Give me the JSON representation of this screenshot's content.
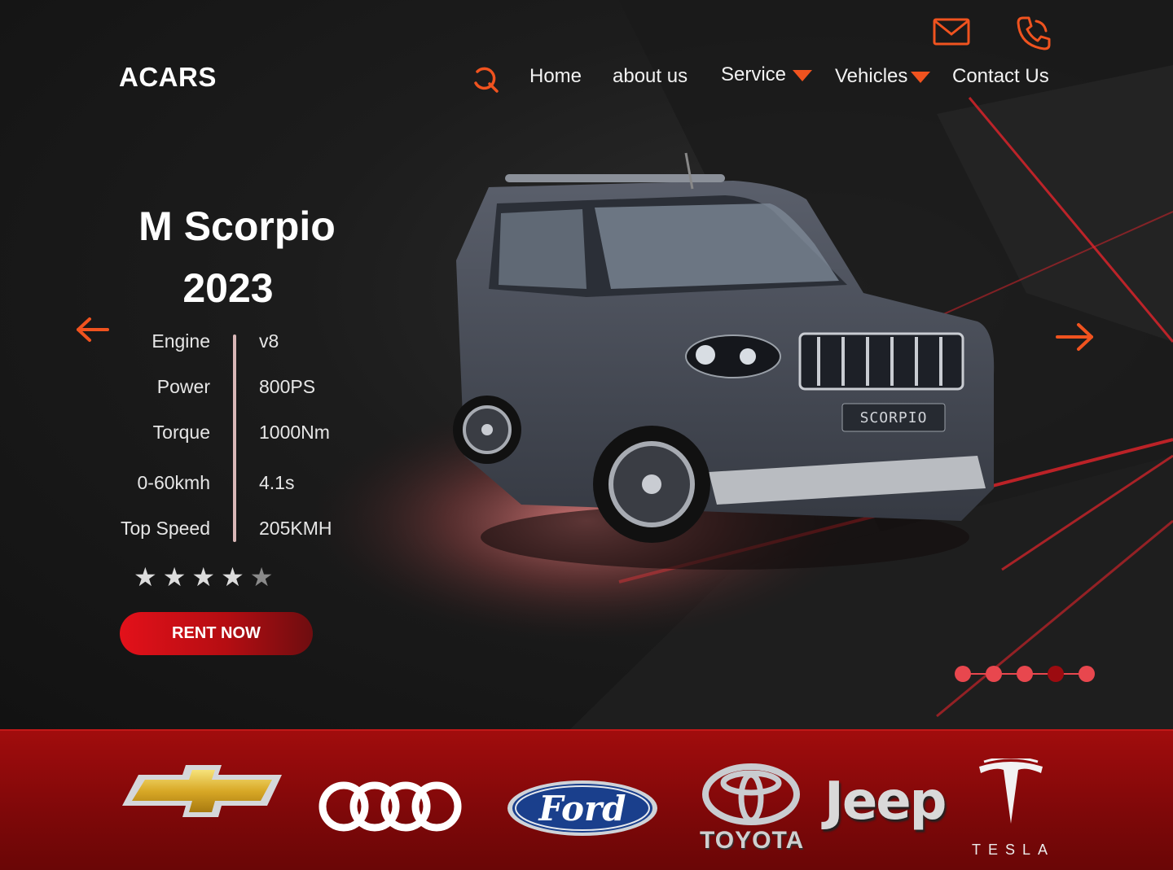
{
  "brand": {
    "name": "ACARS"
  },
  "nav": {
    "items": [
      {
        "label": "Home"
      },
      {
        "label": "about us"
      },
      {
        "label": "Service",
        "has_dropdown": true
      },
      {
        "label": "Vehicles",
        "has_dropdown": true
      },
      {
        "label": "Contact Us"
      }
    ],
    "icons": [
      "search-icon",
      "mail-icon",
      "phone-icon"
    ]
  },
  "hero": {
    "title_line1": "M Scorpio",
    "title_line2": "2023",
    "specs": [
      {
        "label": "Engine",
        "value": "v8"
      },
      {
        "label": "Power",
        "value": "800PS"
      },
      {
        "label": "Torque",
        "value": "1000Nm"
      },
      {
        "label": "0-60kmh",
        "value": "4.1s"
      },
      {
        "label": "Top Speed",
        "value": "205KMH"
      }
    ],
    "rating": {
      "value": 4,
      "max": 5
    },
    "cta_label": "RENT NOW",
    "vehicle_badge": "SCORPIO",
    "carousel": {
      "slides": 5,
      "active": 4
    }
  },
  "brands": {
    "logos": [
      "chevrolet-logo",
      "audi-logo",
      "ford-logo",
      "toyota-logo",
      "jeep-logo",
      "tesla-logo"
    ],
    "ford_text": "Ford",
    "toyota_text": "TOYOTA",
    "jeep_text": "Jeep",
    "tesla_text": "TESLA"
  },
  "colors": {
    "accent": "#f0531f",
    "cta_red": "#e3111a",
    "brand_bar": "#8b0a0b",
    "dot": "#e8474e",
    "dot_active": "#9c0b10"
  }
}
